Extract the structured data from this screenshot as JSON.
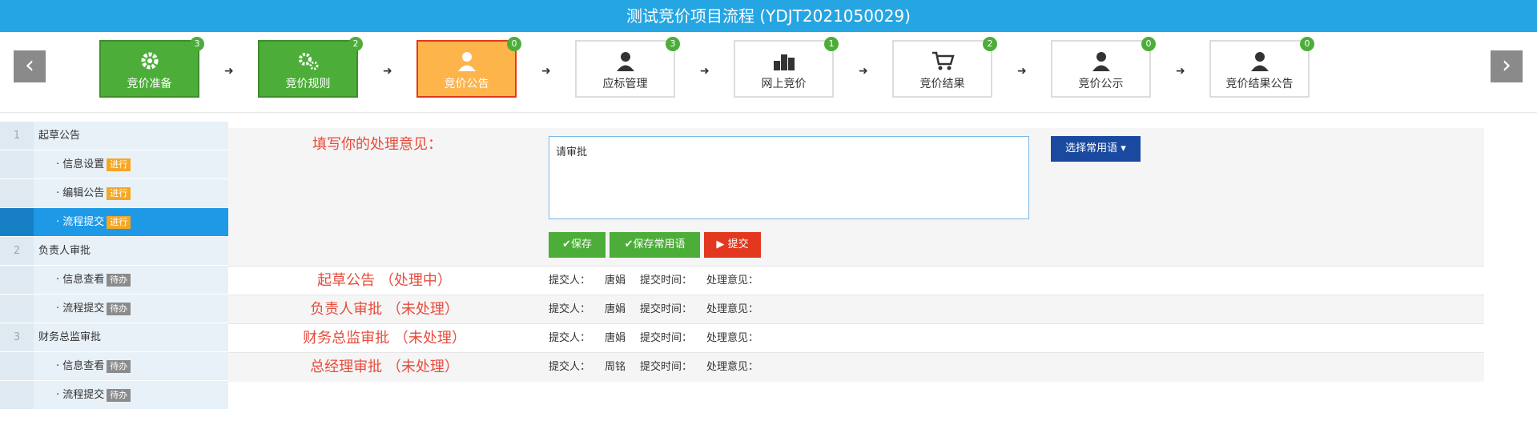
{
  "title": "测试竞价项目流程 (YDJT2021050029)",
  "nav": {
    "prev_icon": "‹",
    "next_icon": "›"
  },
  "steps": [
    {
      "label": "竞价准备",
      "badge": "3",
      "state": "completed",
      "icon": "gear-icon"
    },
    {
      "label": "竞价规则",
      "badge": "2",
      "state": "completed",
      "icon": "gears-icon"
    },
    {
      "label": "竞价公告",
      "badge": "0",
      "state": "current",
      "icon": "user-icon"
    },
    {
      "label": "应标管理",
      "badge": "3",
      "state": "pending",
      "icon": "user-icon"
    },
    {
      "label": "网上竞价",
      "badge": "1",
      "state": "pending",
      "icon": "podium-icon"
    },
    {
      "label": "竞价结果",
      "badge": "2",
      "state": "pending",
      "icon": "cart-icon"
    },
    {
      "label": "竞价公示",
      "badge": "0",
      "state": "pending",
      "icon": "user-icon"
    },
    {
      "label": "竞价结果公告",
      "badge": "0",
      "state": "pending",
      "icon": "user-icon"
    }
  ],
  "sidebar": {
    "items": [
      {
        "num": "1",
        "label": "起草公告",
        "type": "group"
      },
      {
        "label": "· 信息设置",
        "tag": "进行",
        "tag_color": "orange",
        "type": "sub"
      },
      {
        "label": "· 编辑公告",
        "tag": "进行",
        "tag_color": "orange",
        "type": "sub"
      },
      {
        "label": "· 流程提交",
        "tag": "进行",
        "tag_color": "orange",
        "type": "sub",
        "active": true
      },
      {
        "num": "2",
        "label": "负责人审批",
        "type": "group"
      },
      {
        "label": "· 信息查看",
        "tag": "待办",
        "tag_color": "gray",
        "type": "sub"
      },
      {
        "label": "· 流程提交",
        "tag": "待办",
        "tag_color": "gray",
        "type": "sub"
      },
      {
        "num": "3",
        "label": "财务总监审批",
        "type": "group"
      },
      {
        "label": "· 信息查看",
        "tag": "待办",
        "tag_color": "gray",
        "type": "sub"
      },
      {
        "label": "· 流程提交",
        "tag": "待办",
        "tag_color": "gray",
        "type": "sub"
      }
    ]
  },
  "form": {
    "label": "填写你的处理意见：",
    "opinion_value": "请审批",
    "common_phrase_button": "选择常用语",
    "save_button": "保存",
    "save_common_button": "保存常用语",
    "submit_button": "提交"
  },
  "history": [
    {
      "stage": "起草公告 （处理中）",
      "submitter_label": "提交人：",
      "submitter": "唐娟",
      "time_label": "提交时间：",
      "opinion_label": "处理意见："
    },
    {
      "stage": "负责人审批 （未处理）",
      "submitter_label": "提交人：",
      "submitter": "唐娟",
      "time_label": "提交时间：",
      "opinion_label": "处理意见："
    },
    {
      "stage": "财务总监审批 （未处理）",
      "submitter_label": "提交人：",
      "submitter": "唐娟",
      "time_label": "提交时间：",
      "opinion_label": "处理意见："
    },
    {
      "stage": "总经理审批 （未处理）",
      "submitter_label": "提交人：",
      "submitter": "周铭",
      "time_label": "提交时间：",
      "opinion_label": "处理意见："
    }
  ],
  "colors": {
    "header": "#26a5e3",
    "completed": "#4cae39",
    "current": "#fdb44b",
    "active_sidebar": "#1e99e6",
    "stage_text": "#e74c3c"
  }
}
